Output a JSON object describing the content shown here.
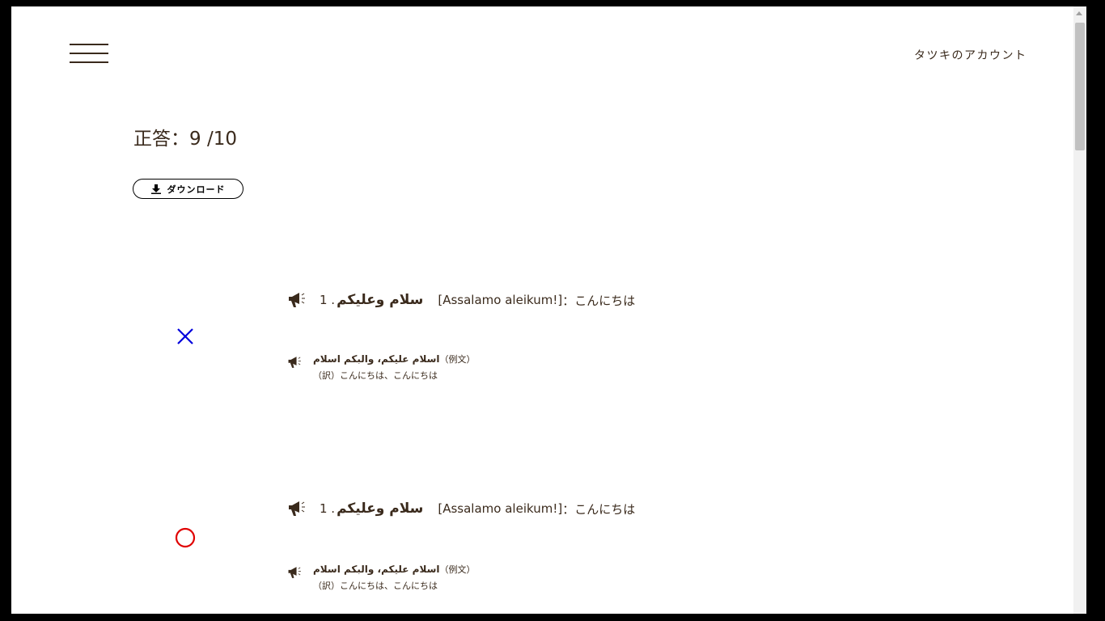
{
  "header": {
    "menu_icon": "hamburger-menu-icon",
    "account_label": "タツキのアカウント"
  },
  "result": {
    "score_text": "正答：9 /10",
    "download_label": "ダウンロード",
    "download_icon": "download-icon"
  },
  "items": [
    {
      "mark": "cross",
      "mark_color": "#0000dd",
      "number": "1 .",
      "arabic": "سلام وعليكم",
      "transliteration": "[Assalamo aleikum!]",
      "meaning": "：こんにちは",
      "example_arabic": "اسلام عليكم، والبكم اسلام",
      "example_label": "（例文）",
      "translation": "（訳）こんにちは、こんにちは"
    },
    {
      "mark": "circle",
      "mark_color": "#e00000",
      "number": "1 .",
      "arabic": "سلام وعليكم",
      "transliteration": "[Assalamo aleikum!]",
      "meaning": "：こんにちは",
      "example_arabic": "اسلام عليكم، والبكم اسلام",
      "example_label": "（例文）",
      "translation": "（訳）こんにちは、こんにちは"
    }
  ]
}
